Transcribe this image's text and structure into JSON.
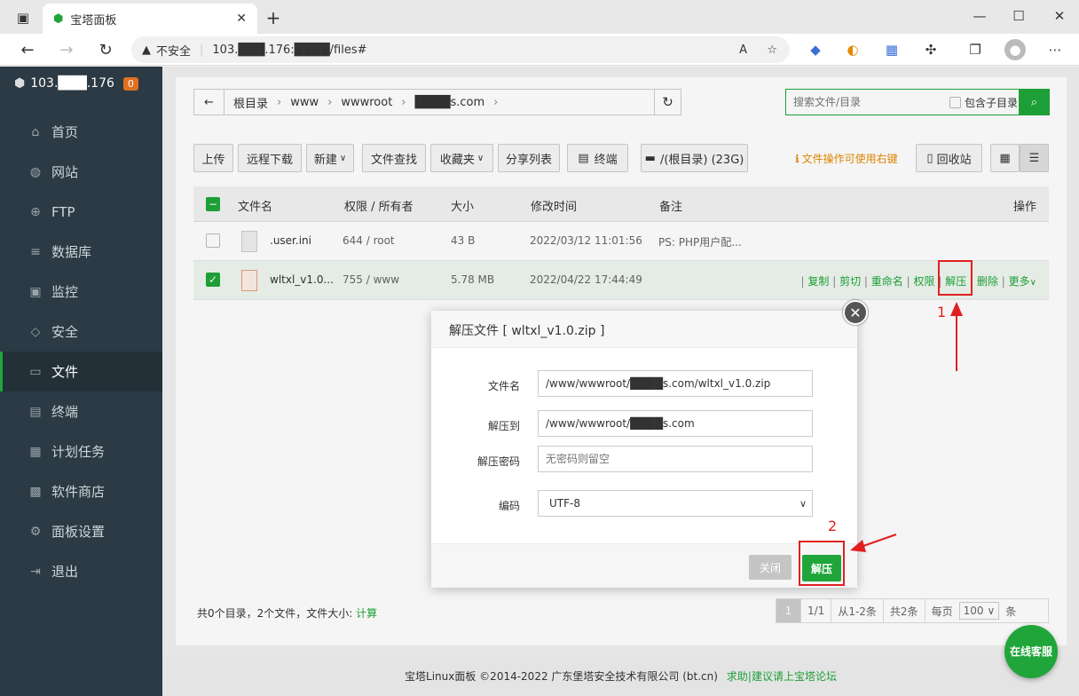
{
  "browser": {
    "tab_title": "宝塔面板",
    "security": "不安全",
    "url": "103.███.176:████/files#"
  },
  "sidebar": {
    "server": "103.███.176",
    "badge": "0",
    "items": [
      {
        "label": "首页",
        "icon": "home-icon",
        "glyph": "⌂"
      },
      {
        "label": "网站",
        "icon": "globe-icon",
        "glyph": "◍"
      },
      {
        "label": "FTP",
        "icon": "ftp-icon",
        "glyph": "⊕"
      },
      {
        "label": "数据库",
        "icon": "database-icon",
        "glyph": "≡"
      },
      {
        "label": "监控",
        "icon": "monitor-icon",
        "glyph": "▣"
      },
      {
        "label": "安全",
        "icon": "shield-icon",
        "glyph": "◇"
      },
      {
        "label": "文件",
        "icon": "folder-icon",
        "glyph": "▭"
      },
      {
        "label": "终端",
        "icon": "terminal-icon",
        "glyph": "▤"
      },
      {
        "label": "计划任务",
        "icon": "calendar-icon",
        "glyph": "▦"
      },
      {
        "label": "软件商店",
        "icon": "apps-icon",
        "glyph": "▩"
      },
      {
        "label": "面板设置",
        "icon": "gear-icon",
        "glyph": "⚙"
      },
      {
        "label": "退出",
        "icon": "logout-icon",
        "glyph": "⇥"
      }
    ]
  },
  "breadcrumb": {
    "items": [
      "根目录",
      "www",
      "wwwroot",
      "████s.com"
    ]
  },
  "search": {
    "placeholder": "搜索文件/目录",
    "subdir_label": "包含子目录"
  },
  "toolbar": {
    "upload": "上传",
    "remote_download": "远程下载",
    "new": "新建",
    "find": "文件查找",
    "favorites": "收藏夹",
    "share_list": "分享列表",
    "terminal": "终端",
    "disk": "/(根目录) (23G)",
    "hint": "文件操作可使用右键",
    "recycle": "回收站"
  },
  "table": {
    "headers": [
      "文件名",
      "权限 / 所有者",
      "大小",
      "修改时间",
      "备注",
      "操作"
    ],
    "rows": [
      {
        "name": ".user.ini",
        "perm": "644 / root",
        "size": "43 B",
        "mtime": "2022/03/12 11:01:56",
        "note": "PS: PHP用户配..."
      },
      {
        "name": "wltxl_v1.0...",
        "perm": "755 / www",
        "size": "5.78 MB",
        "mtime": "2022/04/22 17:44:49",
        "note": "",
        "ops": [
          "复制",
          "剪切",
          "重命名",
          "权限",
          "解压",
          "删除",
          "更多"
        ]
      }
    ]
  },
  "summary": {
    "text": "共0个目录，2个文件，文件大小:",
    "calc": "计算"
  },
  "pager": {
    "current": "1",
    "pages": "1/1",
    "range": "从1-2条",
    "total": "共2条",
    "per_page_label": "每页",
    "per_page": "100",
    "unit": "条"
  },
  "modal": {
    "title": "解压文件 [ wltxl_v1.0.zip ]",
    "filename_label": "文件名",
    "filename": "/www/wwwroot/████s.com/wltxl_v1.0.zip",
    "dest_label": "解压到",
    "dest": "/www/wwwroot/████s.com",
    "pwd_label": "解压密码",
    "pwd_placeholder": "无密码则留空",
    "enc_label": "编码",
    "enc": "UTF-8",
    "close": "关闭",
    "extract": "解压"
  },
  "annotations": {
    "one": "1",
    "two": "2"
  },
  "footer": {
    "copyright": "宝塔Linux面板 ©2014-2022 广东堡塔安全技术有限公司 (bt.cn)",
    "help": "求助|建议请上宝塔论坛"
  },
  "chat": {
    "label": "在线客服"
  },
  "colors": {
    "accent": "#20a53a",
    "sidebar": "#2b3a44",
    "annotation": "#e02020"
  }
}
